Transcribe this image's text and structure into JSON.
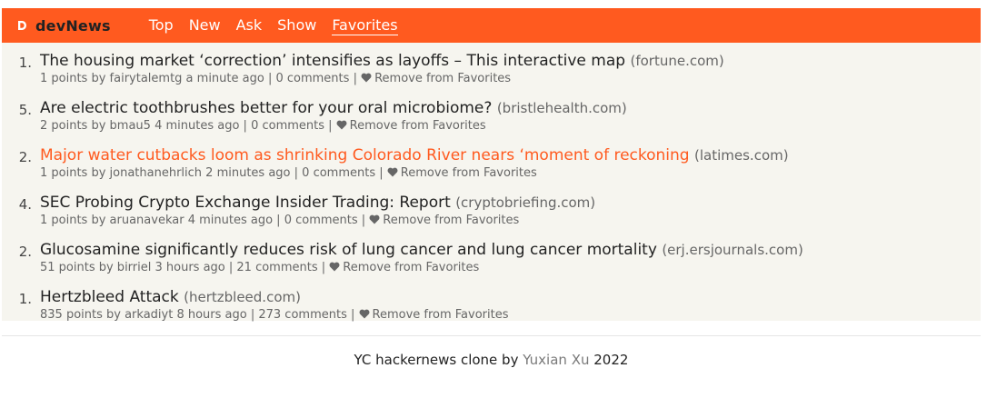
{
  "header": {
    "brand": "devNews",
    "accent_color": "#ff5a1f",
    "logo_icon": "logo-d-icon",
    "nav": [
      {
        "label": "Top"
      },
      {
        "label": "New"
      },
      {
        "label": "Ask"
      },
      {
        "label": "Show"
      },
      {
        "label": "Favorites",
        "active": true
      }
    ]
  },
  "items": [
    {
      "rank": "1.",
      "title": "The housing market ‘correction’ intensifies as layoffs – This interactive map",
      "domain": "(fortune.com)",
      "points": "1 points by fairytalemtg a minute ago",
      "comments": "0 comments",
      "remove": "Remove from Favorites",
      "highlight": false
    },
    {
      "rank": "5.",
      "title": "Are electric toothbrushes better for your oral microbiome?",
      "domain": "(bristlehealth.com)",
      "points": "2 points by bmau5 4 minutes ago",
      "comments": "0 comments",
      "remove": "Remove from Favorites",
      "highlight": false
    },
    {
      "rank": "2.",
      "title": "Major water cutbacks loom as shrinking Colorado River nears ‘moment of reckoning",
      "domain": "(latimes.com)",
      "points": "1 points by jonathanehrlich 2 minutes ago",
      "comments": "0 comments",
      "remove": "Remove from Favorites",
      "highlight": true
    },
    {
      "rank": "4.",
      "title": "SEC Probing Crypto Exchange Insider Trading: Report",
      "domain": "(cryptobriefing.com)",
      "points": "1 points by aruanavekar 4 minutes ago",
      "comments": "0 comments",
      "remove": "Remove from Favorites",
      "highlight": false
    },
    {
      "rank": "2.",
      "title": "Glucosamine significantly reduces risk of lung cancer and lung cancer mortality",
      "domain": "(erj.ersjournals.com)",
      "points": "51 points by birriel 3 hours ago",
      "comments": "21 comments",
      "remove": "Remove from Favorites",
      "highlight": false
    },
    {
      "rank": "1.",
      "title": "Hertzbleed Attack",
      "domain": "(hertzbleed.com)",
      "points": "835 points by arkadiyt 8 hours ago",
      "comments": "273 comments",
      "remove": "Remove from Favorites",
      "highlight": false
    }
  ],
  "footer": {
    "prefix": "YC hackernews clone by",
    "author": "Yuxian Xu",
    "year": "2022"
  }
}
